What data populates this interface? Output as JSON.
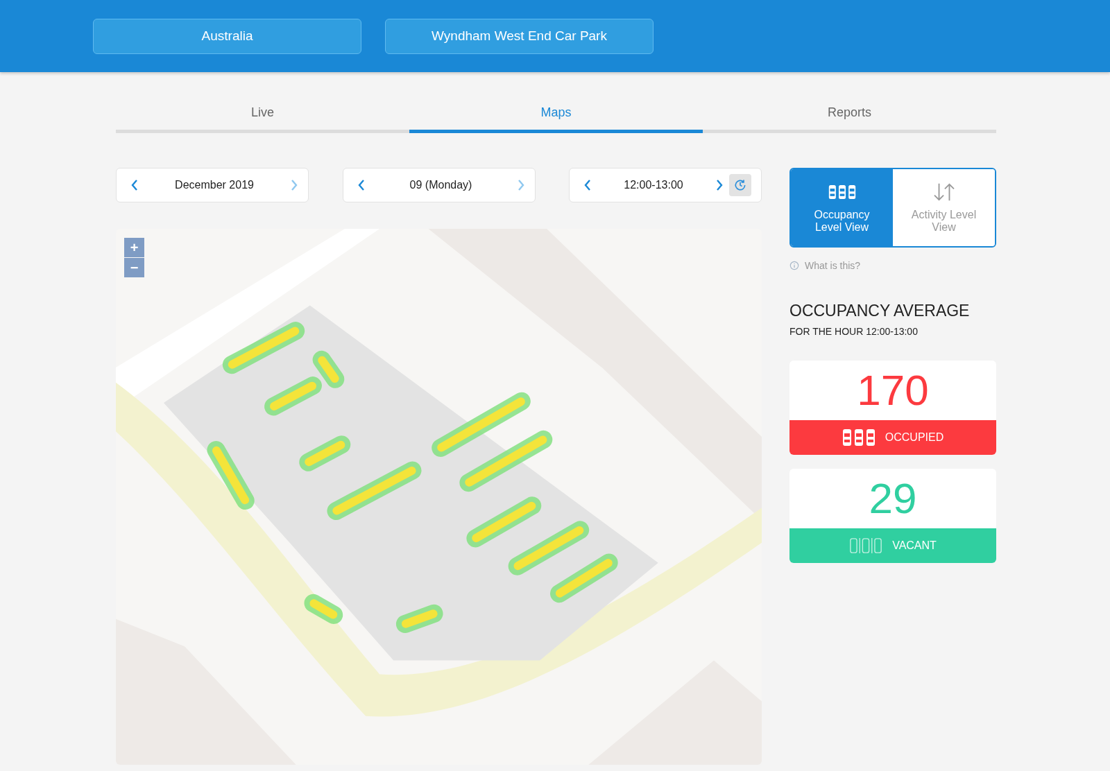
{
  "header": {
    "selectors": [
      "Australia",
      "Wyndham West End Car Park"
    ]
  },
  "tabs": [
    {
      "label": "Live",
      "selected": false
    },
    {
      "label": "Maps",
      "selected": true
    },
    {
      "label": "Reports",
      "selected": false
    }
  ],
  "pickers": [
    {
      "value": "December 2019",
      "prev_disabled": false,
      "next_disabled": true,
      "clock": false
    },
    {
      "value": "09 (Monday)",
      "prev_disabled": false,
      "next_disabled": true,
      "clock": false
    },
    {
      "value": "12:00-13:00",
      "prev_disabled": false,
      "next_disabled": false,
      "clock": true
    }
  ],
  "map": {
    "kind": "picture",
    "zoom_in": "+",
    "zoom_out": "−"
  },
  "view_toggle": [
    {
      "kind": "occupancy",
      "label": "Occupancy Level View",
      "selected": true
    },
    {
      "kind": "activity",
      "label": "Activity Level View",
      "selected": false
    }
  ],
  "help_link": "What is this?",
  "summary": {
    "title": "OCCUPANCY AVERAGE",
    "subtitle": "FOR THE HOUR 12:00-13:00"
  },
  "stats": [
    {
      "kind": "occupied",
      "value": "170",
      "label": "OCCUPIED"
    },
    {
      "kind": "vacant",
      "value": "29",
      "label": "VACANT"
    }
  ]
}
